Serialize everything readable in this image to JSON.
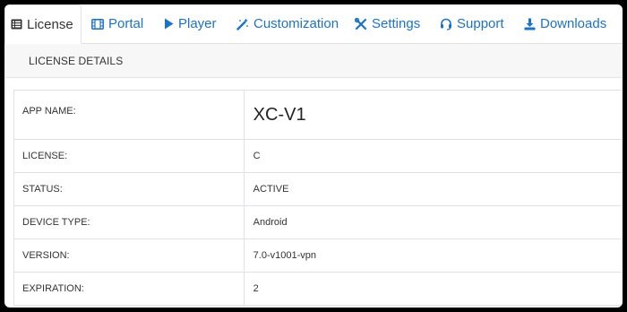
{
  "tabs": [
    {
      "label": "License",
      "icon": "list-icon",
      "active": true
    },
    {
      "label": "Portal",
      "icon": "film-icon",
      "active": false
    },
    {
      "label": "Player",
      "icon": "play-icon",
      "active": false
    },
    {
      "label": "Customization",
      "icon": "magic-wand-icon",
      "active": false
    },
    {
      "label": "Settings",
      "icon": "tools-icon",
      "active": false
    },
    {
      "label": "Support",
      "icon": "headset-icon",
      "active": false
    },
    {
      "label": "Downloads",
      "icon": "download-icon",
      "active": false
    }
  ],
  "card": {
    "header": "LICENSE DETAILS"
  },
  "details": {
    "app_name": {
      "label": "APP NAME:",
      "value": "XC-V1"
    },
    "license": {
      "label": "LICENSE:",
      "value": "C"
    },
    "status": {
      "label": "STATUS:",
      "value": "ACTIVE"
    },
    "device_type": {
      "label": "DEVICE TYPE:",
      "value": "Android"
    },
    "version": {
      "label": "VERSION:",
      "value": "7.0-v1001-vpn"
    },
    "expiration": {
      "label": "EXPIRATION:",
      "value": "2"
    }
  },
  "colors": {
    "link": "#1a73c9",
    "text": "#333333",
    "header_bg": "#f7f7f7",
    "border": "#dee2e6",
    "frame_bg": "#000000"
  }
}
